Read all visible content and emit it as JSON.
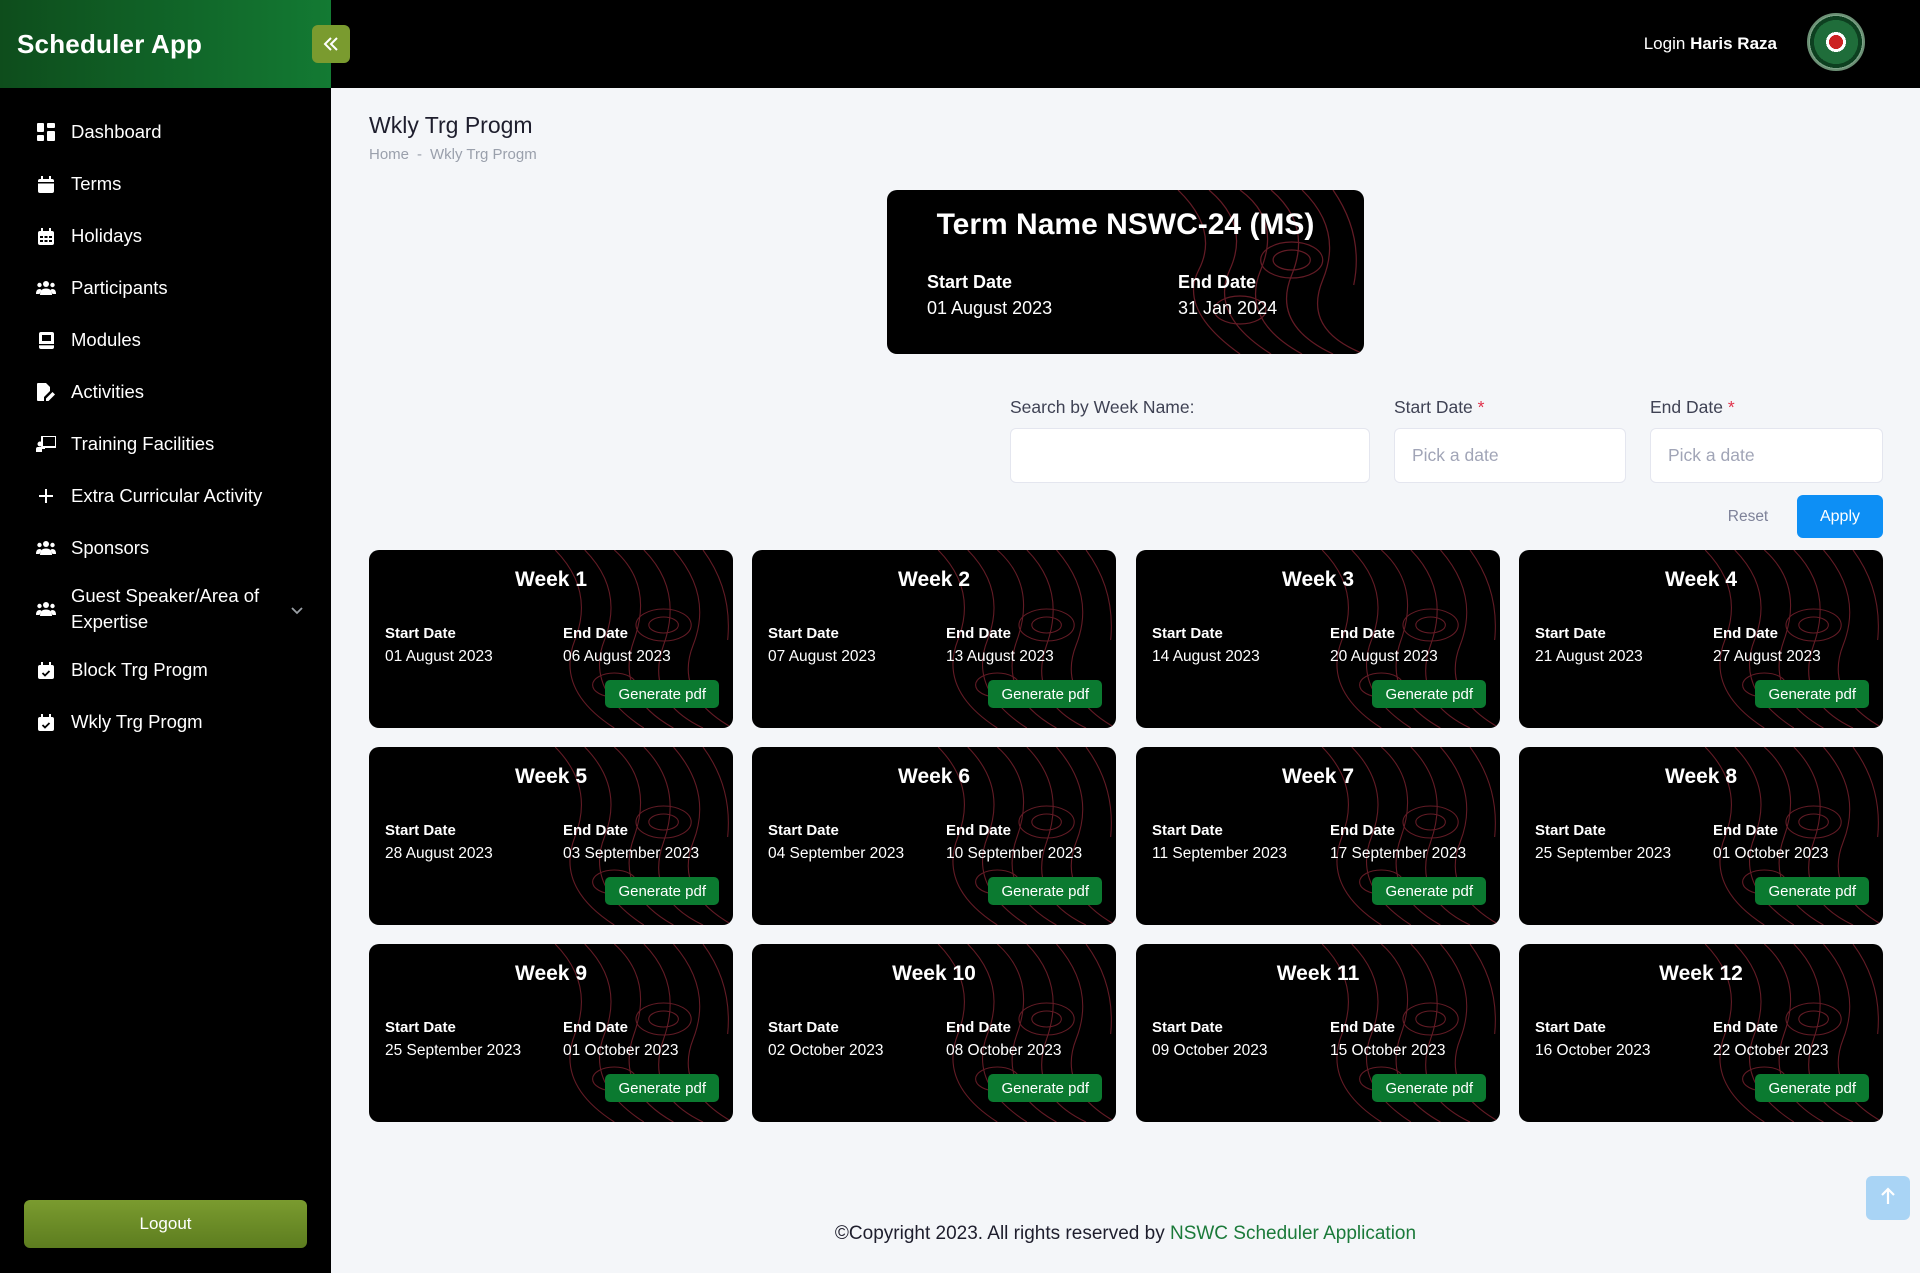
{
  "app": {
    "title": "Scheduler App",
    "collapse_icon": "double-chevron-left-icon"
  },
  "header": {
    "login_prefix": "Login",
    "user_name": "Haris Raza",
    "avatar_icon": "organization-emblem"
  },
  "sidebar": {
    "items": [
      {
        "label": "Dashboard",
        "icon": "dashboard-grid-icon"
      },
      {
        "label": "Terms",
        "icon": "calendar-icon"
      },
      {
        "label": "Holidays",
        "icon": "calendar-days-icon"
      },
      {
        "label": "Participants",
        "icon": "users-icon"
      },
      {
        "label": "Modules",
        "icon": "book-icon"
      },
      {
        "label": "Activities",
        "icon": "file-edit-icon"
      },
      {
        "label": "Training Facilities",
        "icon": "chalkboard-teacher-icon"
      },
      {
        "label": "Extra Curricular Activity",
        "icon": "plus-icon"
      },
      {
        "label": "Sponsors",
        "icon": "users-icon"
      },
      {
        "label": "Guest Speaker/Area of Expertise",
        "icon": "users-icon",
        "has_submenu": true
      },
      {
        "label": "Block Trg Progm",
        "icon": "calendar-check-icon"
      },
      {
        "label": "Wkly Trg Progm",
        "icon": "calendar-check-icon"
      }
    ],
    "logout_label": "Logout"
  },
  "page": {
    "title": "Wkly Trg Progm",
    "breadcrumb": {
      "home": "Home",
      "separator": "-",
      "current": "Wkly Trg Progm"
    }
  },
  "term": {
    "title": "Term Name NSWC-24 (MS)",
    "start_label": "Start Date",
    "start_value": "01 August 2023",
    "end_label": "End Date",
    "end_value": "31 Jan 2024"
  },
  "filters": {
    "search_label": "Search by Week Name:",
    "search_value": "",
    "start_label": "Start Date",
    "start_placeholder": "Pick a date",
    "end_label": "End Date",
    "end_placeholder": "Pick a date",
    "required_mark": "*",
    "reset_label": "Reset",
    "apply_label": "Apply"
  },
  "weeks": {
    "start_label": "Start Date",
    "end_label": "End Date",
    "button_label": "Generate pdf",
    "items": [
      {
        "title": "Week 1",
        "start": "01 August 2023",
        "end": "06 August 2023"
      },
      {
        "title": "Week 2",
        "start": "07 August 2023",
        "end": "13 August 2023"
      },
      {
        "title": "Week 3",
        "start": "14 August 2023",
        "end": "20 August 2023"
      },
      {
        "title": "Week 4",
        "start": "21 August 2023",
        "end": "27 August 2023"
      },
      {
        "title": "Week 5",
        "start": "28 August 2023",
        "end": "03 September 2023"
      },
      {
        "title": "Week 6",
        "start": "04 September 2023",
        "end": "10 September 2023"
      },
      {
        "title": "Week 7",
        "start": "11 September 2023",
        "end": "17 September 2023"
      },
      {
        "title": "Week 8",
        "start": "25 September 2023",
        "end": "01 October 2023"
      },
      {
        "title": "Week 9",
        "start": "25 September 2023",
        "end": "01 October 2023"
      },
      {
        "title": "Week 10",
        "start": "02 October 2023",
        "end": "08 October 2023"
      },
      {
        "title": "Week 11",
        "start": "09 October 2023",
        "end": "15 October 2023"
      },
      {
        "title": "Week 12",
        "start": "16 October 2023",
        "end": "22 October 2023"
      }
    ]
  },
  "footer": {
    "text": "©Copyright 2023. All rights reserved by",
    "link": "NSWC Scheduler Application"
  },
  "colors": {
    "brand_green": "#137a33",
    "button_green": "#0b7a30",
    "accent_blue": "#0d8ff5",
    "olive": "#7a9b2f"
  }
}
